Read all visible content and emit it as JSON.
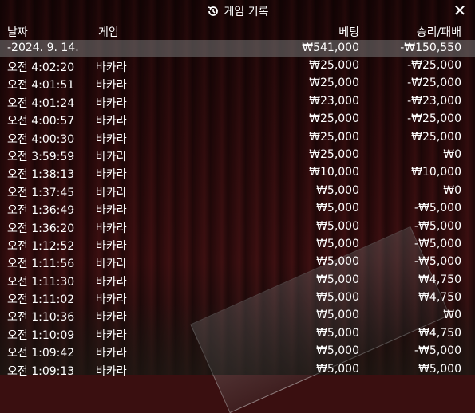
{
  "title": "게임 기록",
  "icons": {
    "history": "history-icon",
    "close": "close-icon"
  },
  "close_glyph": "✕",
  "columns": {
    "date": "날짜",
    "game": "게임",
    "bet": "베팅",
    "win_loss": "승리/패배"
  },
  "summary": {
    "date": "-2024. 9. 14.",
    "bet": "₩541,000",
    "win_loss": "-₩150,550"
  },
  "rows": [
    {
      "time": "오전 4:02:20",
      "game": "바카라",
      "bet": "₩25,000",
      "win_loss": "-₩25,000"
    },
    {
      "time": "오전 4:01:51",
      "game": "바카라",
      "bet": "₩25,000",
      "win_loss": "-₩25,000"
    },
    {
      "time": "오전 4:01:24",
      "game": "바카라",
      "bet": "₩23,000",
      "win_loss": "-₩23,000"
    },
    {
      "time": "오전 4:00:57",
      "game": "바카라",
      "bet": "₩25,000",
      "win_loss": "-₩25,000"
    },
    {
      "time": "오전 4:00:30",
      "game": "바카라",
      "bet": "₩25,000",
      "win_loss": "₩25,000"
    },
    {
      "time": "오전 3:59:59",
      "game": "바카라",
      "bet": "₩25,000",
      "win_loss": "₩0"
    },
    {
      "time": "오전 1:38:13",
      "game": "바카라",
      "bet": "₩10,000",
      "win_loss": "₩10,000"
    },
    {
      "time": "오전 1:37:45",
      "game": "바카라",
      "bet": "₩5,000",
      "win_loss": "₩0"
    },
    {
      "time": "오전 1:36:49",
      "game": "바카라",
      "bet": "₩5,000",
      "win_loss": "-₩5,000"
    },
    {
      "time": "오전 1:36:20",
      "game": "바카라",
      "bet": "₩5,000",
      "win_loss": "-₩5,000"
    },
    {
      "time": "오전 1:12:52",
      "game": "바카라",
      "bet": "₩5,000",
      "win_loss": "-₩5,000"
    },
    {
      "time": "오전 1:11:56",
      "game": "바카라",
      "bet": "₩5,000",
      "win_loss": "-₩5,000"
    },
    {
      "time": "오전 1:11:30",
      "game": "바카라",
      "bet": "₩5,000",
      "win_loss": "₩4,750"
    },
    {
      "time": "오전 1:11:02",
      "game": "바카라",
      "bet": "₩5,000",
      "win_loss": "₩4,750"
    },
    {
      "time": "오전 1:10:36",
      "game": "바카라",
      "bet": "₩5,000",
      "win_loss": "₩0"
    },
    {
      "time": "오전 1:10:09",
      "game": "바카라",
      "bet": "₩5,000",
      "win_loss": "₩4,750"
    },
    {
      "time": "오전 1:09:42",
      "game": "바카라",
      "bet": "₩5,000",
      "win_loss": "-₩5,000"
    },
    {
      "time": "오전 1:09:13",
      "game": "바카라",
      "bet": "₩5,000",
      "win_loss": "₩5,000"
    }
  ]
}
